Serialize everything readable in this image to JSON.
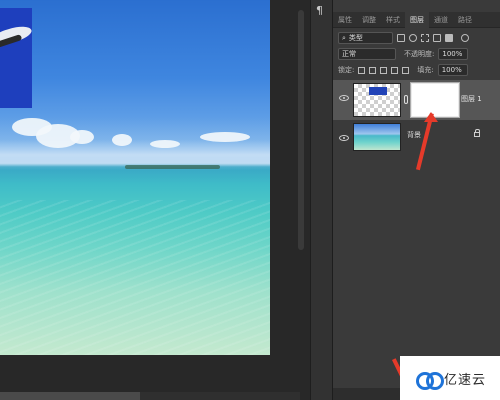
{
  "tabs": [
    "属性",
    "调整",
    "样式",
    "图层",
    "通道",
    "路径"
  ],
  "filter": {
    "label": "类型"
  },
  "blend": {
    "mode": "正常",
    "opacity_label": "不透明度:",
    "opacity": "100%"
  },
  "lock": {
    "label": "锁定:",
    "fill_label": "填充:",
    "fill": "100%"
  },
  "layers": [
    {
      "name": "图层 1"
    },
    {
      "name": "背景"
    }
  ],
  "toolstrip": {
    "para_glyph": "¶"
  },
  "watermark": {
    "text": "亿速云"
  },
  "colors": {
    "accent_arrow": "#e53a2a",
    "panel_bg": "#3a3a3a",
    "selected_layer": "#565656"
  }
}
